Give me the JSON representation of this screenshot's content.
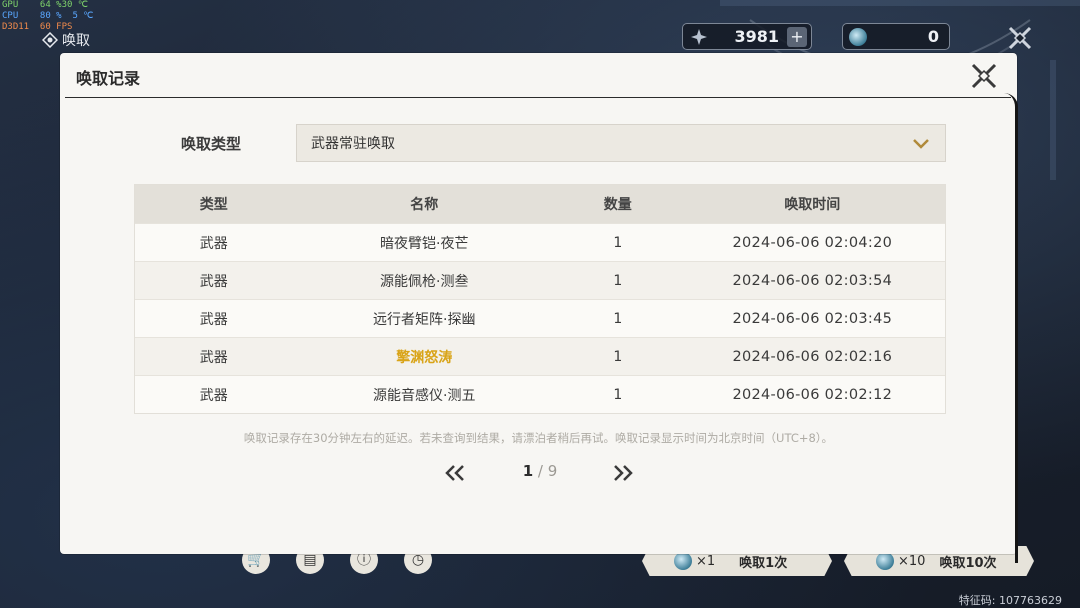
{
  "perf": {
    "gpu": "GPU    64 %30 ℃",
    "cpu": "CPU    80 %  5 ℃",
    "d3d": "D3D11  60 FPS"
  },
  "top_bar": {
    "title": "唤取",
    "currency_a_value": "3981",
    "currency_b_value": "0"
  },
  "modal": {
    "title": "唤取记录",
    "type_label": "唤取类型",
    "type_selected": "武器常驻唤取",
    "columns": [
      "类型",
      "名称",
      "数量",
      "唤取时间"
    ],
    "rows": [
      {
        "type": "武器",
        "name": "暗夜臂铠·夜芒",
        "qty": "1",
        "time": "2024-06-06 02:04:20",
        "highlight": false
      },
      {
        "type": "武器",
        "name": "源能佩枪·测叁",
        "qty": "1",
        "time": "2024-06-06 02:03:54",
        "highlight": false
      },
      {
        "type": "武器",
        "name": "远行者矩阵·探幽",
        "qty": "1",
        "time": "2024-06-06 02:03:45",
        "highlight": false
      },
      {
        "type": "武器",
        "name": "擎渊怒涛",
        "qty": "1",
        "time": "2024-06-06 02:02:16",
        "highlight": true
      },
      {
        "type": "武器",
        "name": "源能音感仪·测五",
        "qty": "1",
        "time": "2024-06-06 02:02:12",
        "highlight": false
      }
    ],
    "note": "唤取记录存在30分钟左右的延迟。若未查询到结果，请漂泊者稍后再试。唤取记录显示时间为北京时间（UTC+8）。",
    "pager": {
      "current": "1",
      "separator": "/",
      "total": "9"
    }
  },
  "bottom_bar": {
    "pull_one_count": "×1",
    "pull_one_label": "唤取1次",
    "pull_ten_count": "×10",
    "pull_ten_label": "唤取10次",
    "feature_code": "特征码: 107763629"
  },
  "colors": {
    "highlight_gold": "#d9a418",
    "modal_bg": "#f7f6f3"
  }
}
